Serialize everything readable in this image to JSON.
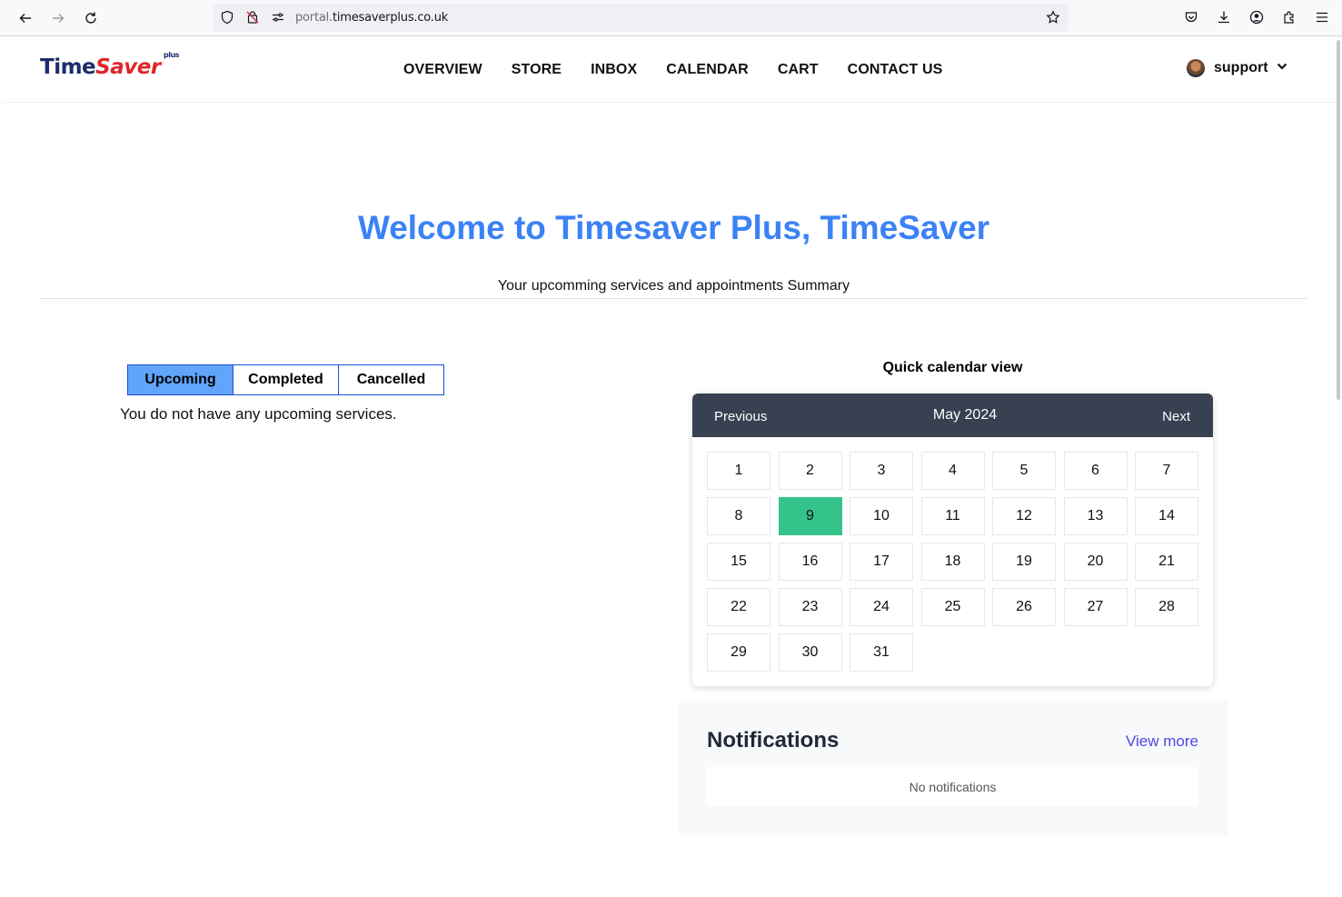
{
  "browser": {
    "url_prefix": "portal.",
    "url_domain": "timesaverplus.co.uk",
    "icons": [
      "back-arrow-icon",
      "forward-arrow-icon",
      "reload-icon",
      "shield-icon",
      "no-cookie-icon",
      "site-settings-icon",
      "bookmark-star-icon",
      "pocket-icon",
      "download-icon",
      "account-icon",
      "extensions-icon",
      "menu-icon"
    ]
  },
  "header": {
    "logo": {
      "time": "Time",
      "saver": "Saver",
      "plus": "plus"
    },
    "nav": [
      "OVERVIEW",
      "STORE",
      "INBOX",
      "CALENDAR",
      "CART",
      "CONTACT US"
    ],
    "user": "support"
  },
  "main": {
    "welcome": "Welcome to Timesaver Plus, TimeSaver",
    "subtitle": "Your upcomming services and appointments Summary",
    "tabs": [
      "Upcoming",
      "Completed",
      "Cancelled"
    ],
    "active_tab": "Upcoming",
    "empty_message": "You do not have any upcoming services."
  },
  "calendar": {
    "heading": "Quick calendar view",
    "prev": "Previous",
    "month": "May 2024",
    "next": "Next",
    "days": [
      "1",
      "2",
      "3",
      "4",
      "5",
      "6",
      "7",
      "8",
      "9",
      "10",
      "11",
      "12",
      "13",
      "14",
      "15",
      "16",
      "17",
      "18",
      "19",
      "20",
      "21",
      "22",
      "23",
      "24",
      "25",
      "26",
      "27",
      "28",
      "29",
      "30",
      "31"
    ],
    "today": "9",
    "today_color": "#34c38a",
    "header_color": "#374151"
  },
  "notifications": {
    "title": "Notifications",
    "view_more": "View more",
    "empty": "No notifications"
  },
  "colors": {
    "accent_blue": "#3b82f6",
    "active_tab": "#60a5fa",
    "link": "#4f46e5"
  }
}
